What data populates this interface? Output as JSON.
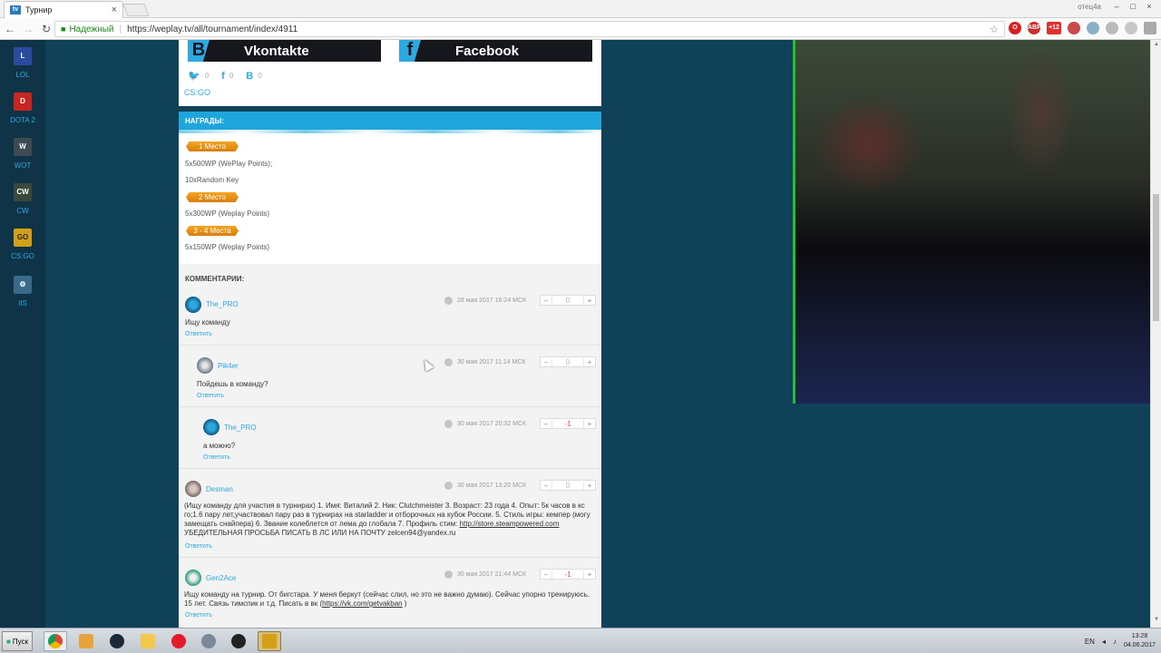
{
  "browser": {
    "tab_title": "Турнир",
    "favicon_text": "tv",
    "secure_label": "Надежный",
    "url": "https://weplay.tv/all/tournament/index/4911",
    "user_label": "отец4а",
    "ext_badge": "+12"
  },
  "sidebar": {
    "games": [
      {
        "label": "LOL",
        "icon": "lol-icon",
        "color": "#2b4aa0",
        "glyph": "L"
      },
      {
        "label": "DOTA 2",
        "icon": "dota2-icon",
        "color": "#c8261e",
        "glyph": "D"
      },
      {
        "label": "WOT",
        "icon": "wot-icon",
        "color": "#3f4b52",
        "glyph": "W"
      },
      {
        "label": "CW",
        "icon": "cw-icon",
        "color": "#3a4a3a",
        "glyph": "CW"
      },
      {
        "label": "CS:GO",
        "icon": "csgo-icon",
        "color": "#d4a017",
        "glyph": "GO"
      },
      {
        "label": "IIS",
        "icon": "iis-icon",
        "color": "#3a6a8a",
        "glyph": "⚙"
      }
    ]
  },
  "share": {
    "vk_button": "Vkontakte",
    "fb_button": "Facebook",
    "counts": {
      "twitter": "0",
      "facebook": "0",
      "vk": "0"
    },
    "tag": "CS:GO"
  },
  "prizes": {
    "heading": "НАГРАДЫ:",
    "places": [
      {
        "badge": "1 Место",
        "lines": [
          "5x500WP (WePlay Points);",
          "10xRandom Key"
        ]
      },
      {
        "badge": "2 Место",
        "lines": [
          "5x300WP (Weplay Points)"
        ]
      },
      {
        "badge": "3 - 4 Места",
        "lines": [
          "5x150WP (Weplay Points)"
        ]
      }
    ]
  },
  "comments": {
    "heading": "КОММЕНТАРИИ:",
    "reply_label": "Ответить",
    "items": [
      {
        "author": "The_PRO",
        "date": "28 мая 2017 16:24 МСК",
        "vote": "0",
        "text": "Ищу команду"
      },
      {
        "author": "Pik4er",
        "date": "30 мая 2017 11:14 МСК",
        "vote": "0",
        "text": "Пойдешь в команду?"
      },
      {
        "author": "The_PRO",
        "date": "30 мая 2017 20:32 МСК",
        "vote": "-1",
        "text": "а можно?"
      },
      {
        "author": "Desman",
        "date": "30 мая 2017 13:20 МСК",
        "vote": "0",
        "text": "(Ищу команду для участия в турнирах) 1. Имя: Виталий 2. Ник: Clutchmeister 3. Возраст: 23 года 4. Опыт: 5к часов в кс го;1.6 пару лет,участвовал пару раз в турнирах на starladder и отборочных на кубок России. 5. Стиль игры: кемпер (могу замещать снайпера) 6. Звание колеблется от лема до глобала 7. Профиль стим:",
        "link": "http://store.steampowered.com",
        "tail": "УБЕДИТЕЛЬНАЯ ПРОСЬБА ПИСАТЬ В ЛС ИЛИ НА ПОЧТУ zelcen94@yandex.ru"
      },
      {
        "author": "Gen2Ace",
        "date": "30 мая 2017 21:44 МСК",
        "vote": "-1",
        "text": "Ищу команду на турнир. От бигстара. У меня беркут (сейчас слил, но это не важно думаю). Сейчас упорно тренируюсь. 15 лет. Связь тимспик и т.д. Писать в вк (",
        "link": "https://vk.com/getvakban",
        "tail": ")"
      }
    ]
  },
  "taskbar": {
    "start_label": "Пуск",
    "lang": "EN",
    "time": "13:28",
    "date": "04.06.2017"
  }
}
